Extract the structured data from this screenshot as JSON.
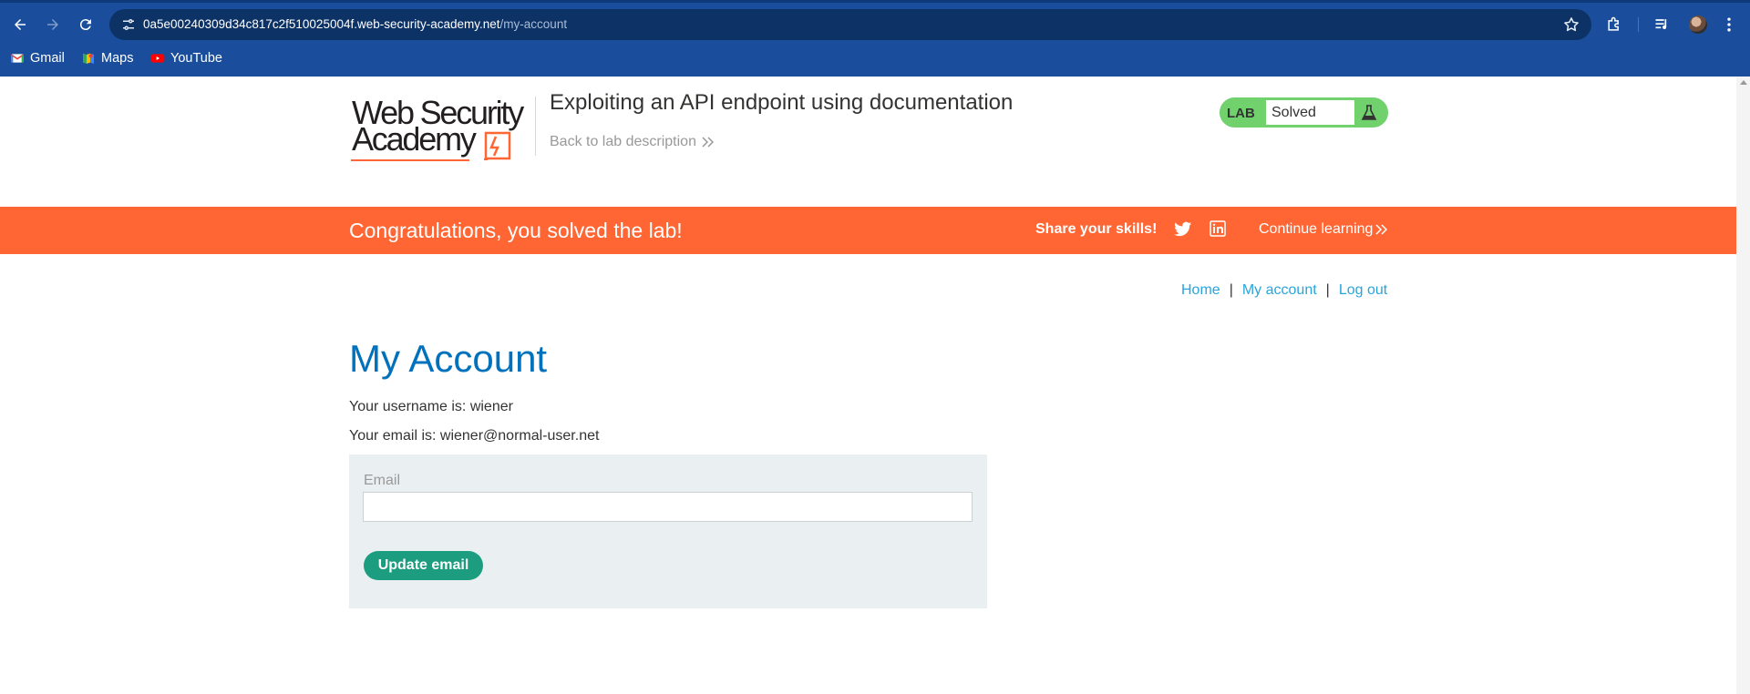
{
  "browser": {
    "url_host": "0a5e00240309d34c817c2f510025004f.web-security-academy.net",
    "url_path": "/my-account",
    "bookmarks": [
      {
        "label": "Gmail",
        "icon": "gmail-icon"
      },
      {
        "label": "Maps",
        "icon": "maps-icon"
      },
      {
        "label": "YouTube",
        "icon": "youtube-icon"
      }
    ]
  },
  "header": {
    "logo_line1": "Web Security",
    "logo_line2": "Academy",
    "lab_title": "Exploiting an API endpoint using documentation",
    "back_link": "Back to lab description",
    "lab_badge_label": "LAB",
    "lab_status": "Solved"
  },
  "banner": {
    "congrats": "Congratulations, you solved the lab!",
    "share": "Share your skills!",
    "continue": "Continue learning"
  },
  "nav": {
    "home": "Home",
    "my_account": "My account",
    "log_out": "Log out",
    "separator": "|"
  },
  "account": {
    "title": "My Account",
    "username_line": "Your username is: wiener",
    "email_line": "Your email is: wiener@normal-user.net",
    "email_label": "Email",
    "email_value": "",
    "update_button": "Update email"
  },
  "colors": {
    "chrome": "#1a4e9c",
    "banner": "#ff6633",
    "heading": "#0071bc",
    "link": "#29a5dc",
    "button": "#1c9d7f",
    "badge": "#70d16d"
  }
}
